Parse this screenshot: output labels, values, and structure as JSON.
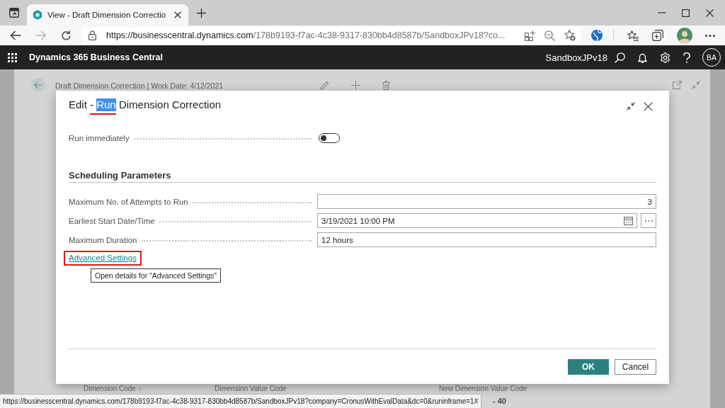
{
  "browser": {
    "tabs": [
      {
        "title": "View - Draft Dimension Correctio",
        "selected": true
      }
    ],
    "nav_buttons": [
      {
        "kind": "back",
        "disabled": false
      },
      {
        "kind": "forward",
        "disabled": true
      },
      {
        "kind": "refresh",
        "disabled": false
      }
    ],
    "address": {
      "origin": "https://businesscentral.dynamics.com",
      "path": "/178b9193-f7ac-4c38-9317-830bb4d8587b/SandboxJPv18?co..."
    }
  },
  "app_bar": {
    "title": "Dynamics 365 Business Central",
    "environment": "SandboxJPv18",
    "user_initials": "BA"
  },
  "background_page": {
    "title": "Draft Dimension Correction | Work Date: 4/12/2021",
    "columns": [
      "Dimension Code ↑",
      "Dimension Value Code",
      "New Dimension Value Code"
    ],
    "row_fragment": "- 40"
  },
  "dialog": {
    "title_parts": [
      {
        "text": "Edit ",
        "highlighted": false,
        "underlined": false
      },
      {
        "text": "- ",
        "highlighted": false,
        "underlined": true
      },
      {
        "text": "Run",
        "highlighted": true,
        "underlined": true
      },
      {
        "text": " Dimension Correction",
        "highlighted": false,
        "underlined": false
      }
    ],
    "fields": [
      {
        "kind": "toggle",
        "label": "Run immediately",
        "on": false
      }
    ],
    "section": {
      "title": "Scheduling Parameters",
      "fields": [
        {
          "kind": "number",
          "label": "Maximum No. of Attempts to Run",
          "value": "3"
        },
        {
          "kind": "datetime",
          "label": "Earliest Start Date/Time",
          "value": "3/19/2021 10:00 PM"
        },
        {
          "kind": "text",
          "label": "Maximum Duration",
          "value": "12 hours"
        }
      ]
    },
    "link": {
      "text": "Advanced Settings",
      "annotated": true
    },
    "tooltip": "Open details for \"Advanced Settings\"",
    "buttons": [
      {
        "kind": "primary",
        "label": "OK"
      },
      {
        "kind": "secondary",
        "label": "Cancel"
      }
    ]
  },
  "status_bar": {
    "url": "https://businesscentral.dynamics.com/178b9193-f7ac-4c38-9317-830bb4d8587b/SandboxJPv18?company=CronusWithEvalData&dc=0&runinframe=1#"
  }
}
